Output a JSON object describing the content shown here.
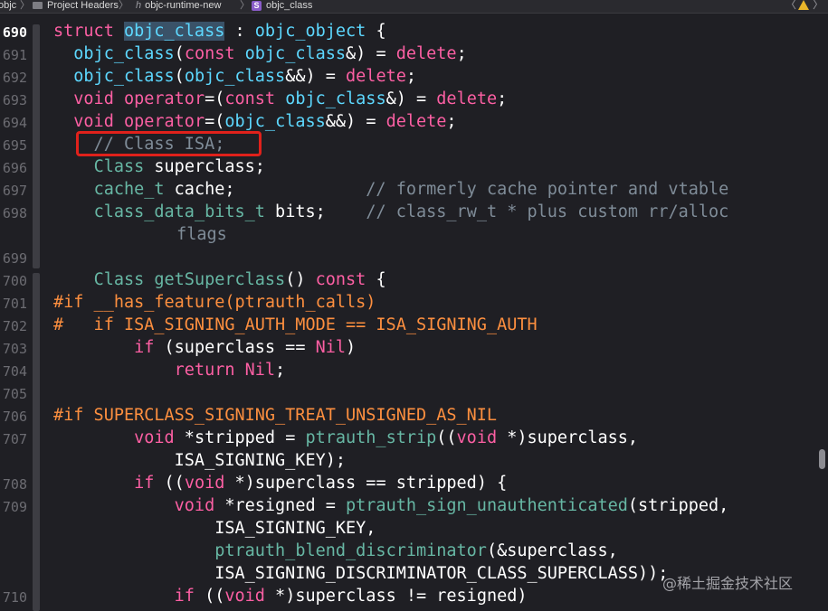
{
  "jumpbar": {
    "items": [
      "objc",
      "Project Headers",
      "objc-runtime-new",
      "objc_class"
    ],
    "separator": "〉",
    "h_glyph": "h",
    "s_glyph": "S",
    "nav_prev": "〈",
    "nav_next": "〉",
    "warning_icon": "warning-icon"
  },
  "line_numbers": [
    "690",
    "691",
    "692",
    "693",
    "694",
    "695",
    "696",
    "697",
    "698",
    "699",
    "700",
    "701",
    "702",
    "703",
    "704",
    "705",
    "706",
    "707",
    "708",
    "709",
    "710"
  ],
  "code": {
    "l0": {
      "a": "struct ",
      "b": "objc_class",
      "c": " : ",
      "d": "objc_object",
      " e": "",
      "e": " {"
    },
    "l1": {
      "a": "  ",
      "b": "objc_class",
      "c": "(",
      "d": "const ",
      "e": "objc_class",
      "f": "&) = ",
      "g": "delete",
      ";": ";",
      "h": ";"
    },
    "l2": {
      "a": "  ",
      "b": "objc_class",
      "c": "(",
      "d": "objc_class",
      "e": "&&) = ",
      "f": "delete",
      "g": ";"
    },
    "l3": {
      "a": "  ",
      "b": "void ",
      "c": "operator",
      "d": "=(",
      "e": "const ",
      "f": "objc_class",
      "g": "&) = ",
      "h": "delete",
      "i": ";"
    },
    "l4": {
      "a": "  ",
      "b": "void ",
      "c": "operator",
      "d": "=(",
      "e": "objc_class",
      "f": "&&) = ",
      "g": "delete",
      "h": ";"
    },
    "l5": {
      "a": "    // Class ISA;"
    },
    "l6": {
      "a": "    ",
      "b": "Class",
      " c": "",
      "c": " superclass;"
    },
    "l7": {
      "a": "    ",
      "b": "cache_t",
      " c": "",
      "c": " cache;             ",
      "d": "// formerly cache pointer and vtable"
    },
    "l8": {
      "a": "    ",
      "b": "class_data_bits_t",
      " c": "",
      "c": " bits;    ",
      "d": "// class_rw_t * plus custom rr/alloc"
    },
    "l8b": {
      "a": "        flags"
    },
    "l9": {
      "a": "    ",
      "b": "Class ",
      "c": "getSuperclass",
      "d": "() ",
      "e": "const",
      " f": "",
      "f": " {"
    },
    "l10": {
      "a": "#if __has_feature(ptrauth_calls)"
    },
    "l11": {
      "a": "#   if ISA_SIGNING_AUTH_MODE == ISA_SIGNING_AUTH"
    },
    "l12": {
      "a": "        ",
      "b": "if",
      " c": "",
      "c": " (superclass == ",
      "d": "Nil",
      "e": ")"
    },
    "l13": {
      "a": "            ",
      "b": "return ",
      "c": "Nil",
      ";": ";",
      "d": ";"
    },
    "l14": {
      "a": "#if SUPERCLASS_SIGNING_TREAT_UNSIGNED_AS_NIL"
    },
    "l15": {
      "a": "        ",
      "b": "void",
      " c": "",
      "c": " *stripped = ",
      "d": "ptrauth_strip",
      "e": "((",
      "f": "void",
      " g": "",
      "g": " *)superclass,"
    },
    "l15b": {
      "a": "            ISA_SIGNING_KEY);"
    },
    "l16": {
      "a": "        ",
      "b": "if",
      " c": "",
      "c": " ((",
      "d": "void",
      " e": "",
      "e": " *)superclass == stripped) {"
    },
    "l17": {
      "a": "            ",
      "b": "void",
      " c": "",
      "c": " *resigned = ",
      "d": "ptrauth_sign_unauthenticated",
      "e": "(stripped,"
    },
    "l17b": {
      "a": "                ISA_SIGNING_KEY,"
    },
    "l17c": {
      "a": "                ",
      "b": "ptrauth_blend_discriminator",
      "c": "(&superclass,"
    },
    "l17d": {
      "a": "                ISA_SIGNING_DISCRIMINATOR_CLASS_SUPERCLASS));"
    },
    "l18": {
      "a": "            ",
      "b": "if",
      " c": "",
      "c": " ((",
      "d": "void",
      " e": "",
      "e": " *)superclass != resigned)"
    }
  },
  "watermark": "@稀土掘金技术社区",
  "colors": {
    "background": "#1f1f24",
    "keyword": "#fc5fa3",
    "type": "#5dd8ff",
    "function": "#67b7a4",
    "comment": "#7f8c98",
    "preprocessor": "#fd8f3f",
    "nil": "#d0bf69",
    "highlight_box": "#e0211b"
  }
}
